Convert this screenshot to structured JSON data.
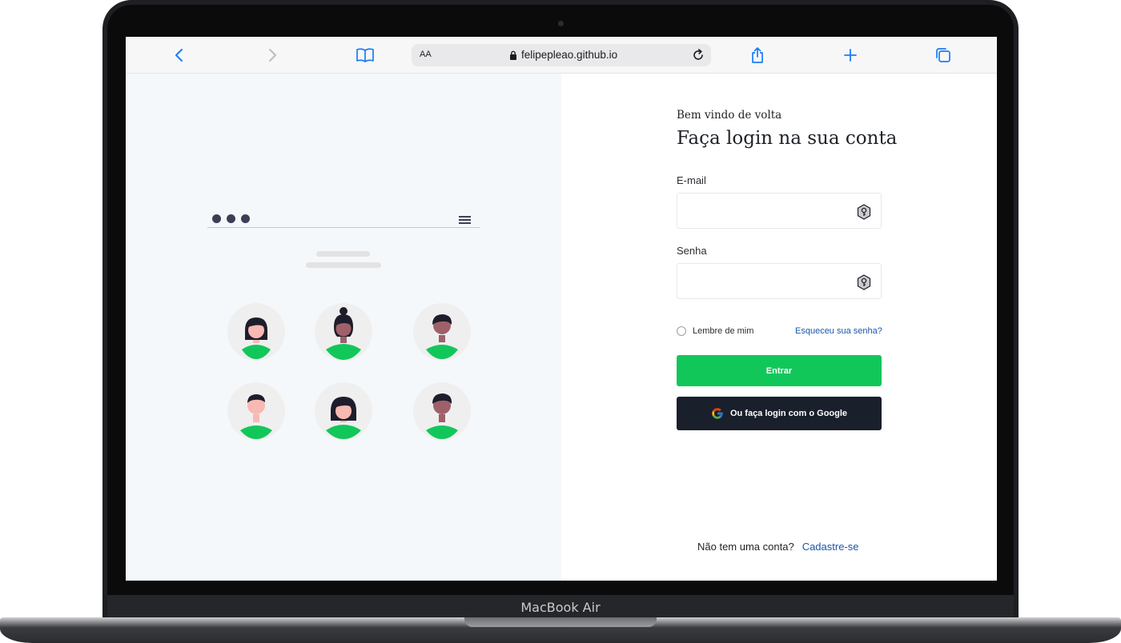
{
  "device": {
    "brand_label": "MacBook Air"
  },
  "browser": {
    "text_size_label": "AA",
    "url": "felipepleao.github.io",
    "icons": [
      "back-icon",
      "forward-icon",
      "bookmarks-icon",
      "lock-icon",
      "reload-icon",
      "share-icon",
      "new-tab-icon",
      "tabs-icon"
    ]
  },
  "illustration": {
    "avatars": [
      {
        "hair": "#1f1d2b",
        "skin": "#f8b9b3",
        "shirt": "#12c75a"
      },
      {
        "hair": "#1f1d2b",
        "skin": "#9e616a",
        "shirt": "#12c75a"
      },
      {
        "hair": "#1f1d2b",
        "skin": "#9e616a",
        "shirt": "#12c75a"
      },
      {
        "hair": "#1f1d2b",
        "skin": "#f8b9b3",
        "shirt": "#12c75a"
      },
      {
        "hair": "#1f1d2b",
        "skin": "#f8b9b3",
        "shirt": "#12c75a"
      },
      {
        "hair": "#1f1d2b",
        "skin": "#9e616a",
        "shirt": "#12c75a"
      }
    ]
  },
  "login": {
    "welcome": "Bem vindo de volta",
    "title": "Faça login na sua conta",
    "email_label": "E-mail",
    "email_value": "",
    "password_label": "Senha",
    "password_value": "",
    "remember_label": "Lembre de mim",
    "forgot_link": "Esqueceu sua senha?",
    "submit_label": "Entrar",
    "google_label": "Ou faça login com o Google",
    "no_account_text": "Não tem uma conta?",
    "signup_link": "Cadastre-se"
  },
  "colors": {
    "accent_green": "#12c75a",
    "dark_button": "#1a1f2c",
    "link_blue": "#1a56a8",
    "left_panel_bg": "#f5f8fa"
  }
}
